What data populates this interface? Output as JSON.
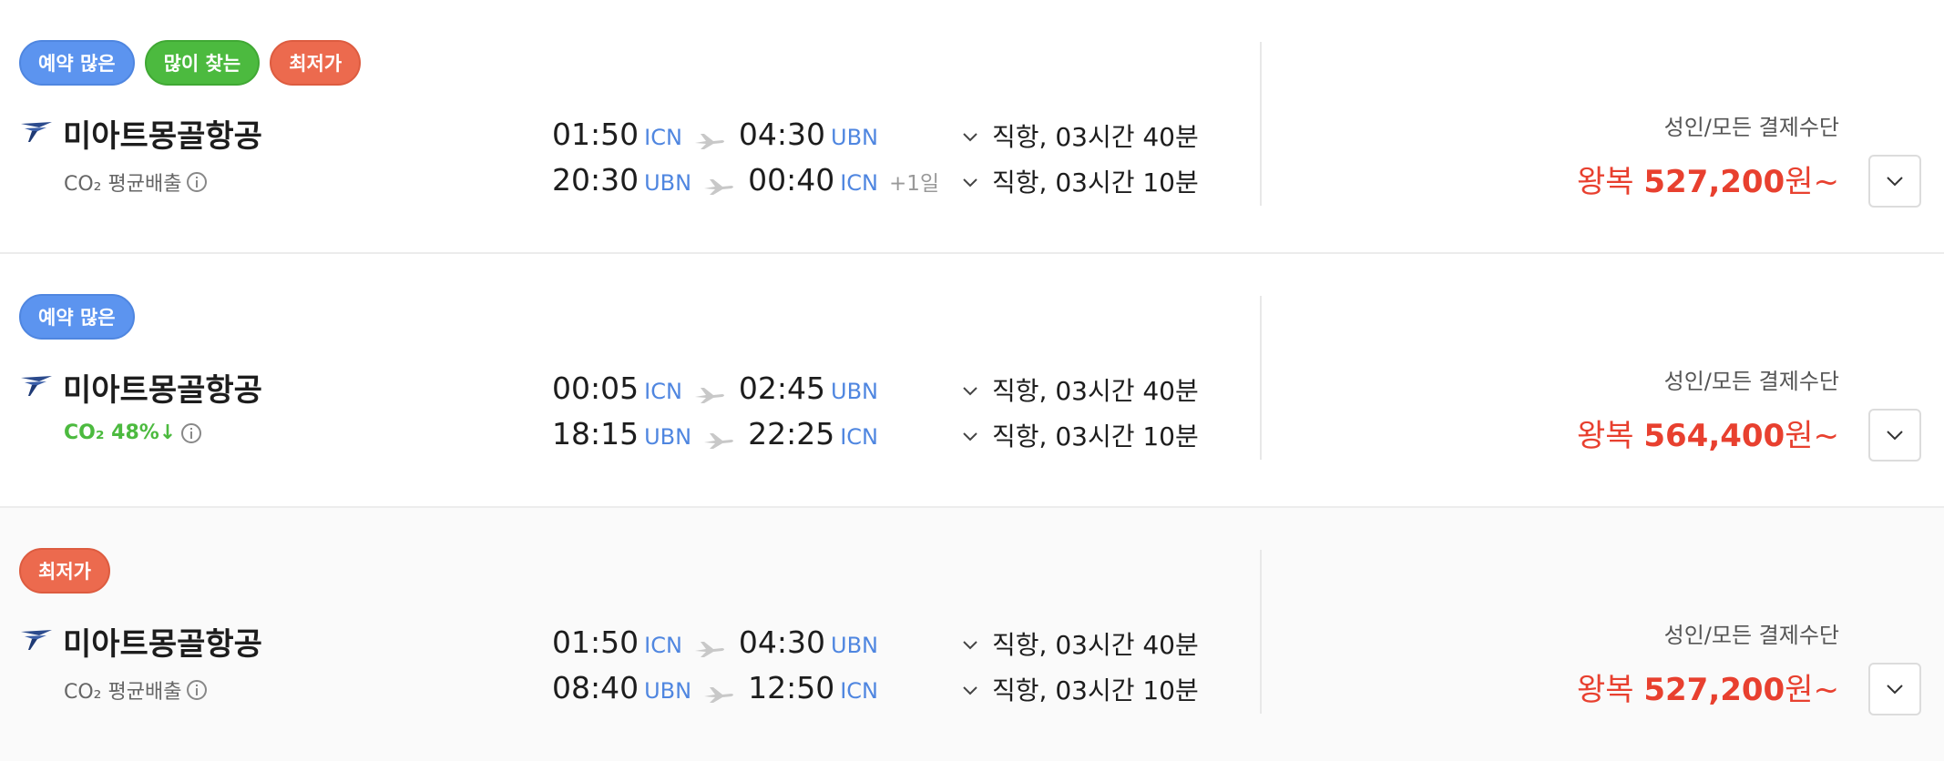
{
  "results": [
    {
      "badges": [
        {
          "label": "예약 많은",
          "color": "#5c94ef"
        },
        {
          "label": "많이 찾는",
          "color": "#4cba3f"
        },
        {
          "label": "최저가",
          "color": "#ec6a4e"
        }
      ],
      "airline": "미아트몽골항공",
      "co2": {
        "label": "CO₂ 평균배출",
        "highlight": false
      },
      "legs": [
        {
          "dep_time": "01:50",
          "dep_code": "ICN",
          "arr_time": "04:30",
          "arr_code": "UBN",
          "day_offset": ""
        },
        {
          "dep_time": "20:30",
          "dep_code": "UBN",
          "arr_time": "00:40",
          "arr_code": "ICN",
          "day_offset": "+1일"
        }
      ],
      "routes": [
        "직항, 03시간 40분",
        "직항, 03시간 10분"
      ],
      "price_label": "성인/모든 결제수단",
      "price_prefix": "왕복 ",
      "price_amount": "527,200",
      "price_suffix": "원~"
    },
    {
      "badges": [
        {
          "label": "예약 많은",
          "color": "#5c94ef"
        }
      ],
      "airline": "미아트몽골항공",
      "co2": {
        "label": "CO₂ 48%↓",
        "highlight": true
      },
      "legs": [
        {
          "dep_time": "00:05",
          "dep_code": "ICN",
          "arr_time": "02:45",
          "arr_code": "UBN",
          "day_offset": ""
        },
        {
          "dep_time": "18:15",
          "dep_code": "UBN",
          "arr_time": "22:25",
          "arr_code": "ICN",
          "day_offset": ""
        }
      ],
      "routes": [
        "직항, 03시간 40분",
        "직항, 03시간 10분"
      ],
      "price_label": "성인/모든 결제수단",
      "price_prefix": "왕복 ",
      "price_amount": "564,400",
      "price_suffix": "원~"
    },
    {
      "badges": [
        {
          "label": "최저가",
          "color": "#ec6a4e"
        }
      ],
      "airline": "미아트몽골항공",
      "co2": {
        "label": "CO₂ 평균배출",
        "highlight": false
      },
      "legs": [
        {
          "dep_time": "01:50",
          "dep_code": "ICN",
          "arr_time": "04:30",
          "arr_code": "UBN",
          "day_offset": ""
        },
        {
          "dep_time": "08:40",
          "dep_code": "UBN",
          "arr_time": "12:50",
          "arr_code": "ICN",
          "day_offset": ""
        }
      ],
      "routes": [
        "직항, 03시간 40분",
        "직항, 03시간 10분"
      ],
      "price_label": "성인/모든 결제수단",
      "price_prefix": "왕복 ",
      "price_amount": "527,200",
      "price_suffix": "원~"
    }
  ],
  "icons": {
    "airline_logo": "airline-logo-icon",
    "plane": "plane-icon",
    "route_expand": "chevron-down-icon",
    "info": "info-icon",
    "card_expand": "chevron-down-icon"
  },
  "colors": {
    "accent_blue": "#4f86e0",
    "price_red": "#e8402f",
    "eco_green": "#4cba3f"
  }
}
